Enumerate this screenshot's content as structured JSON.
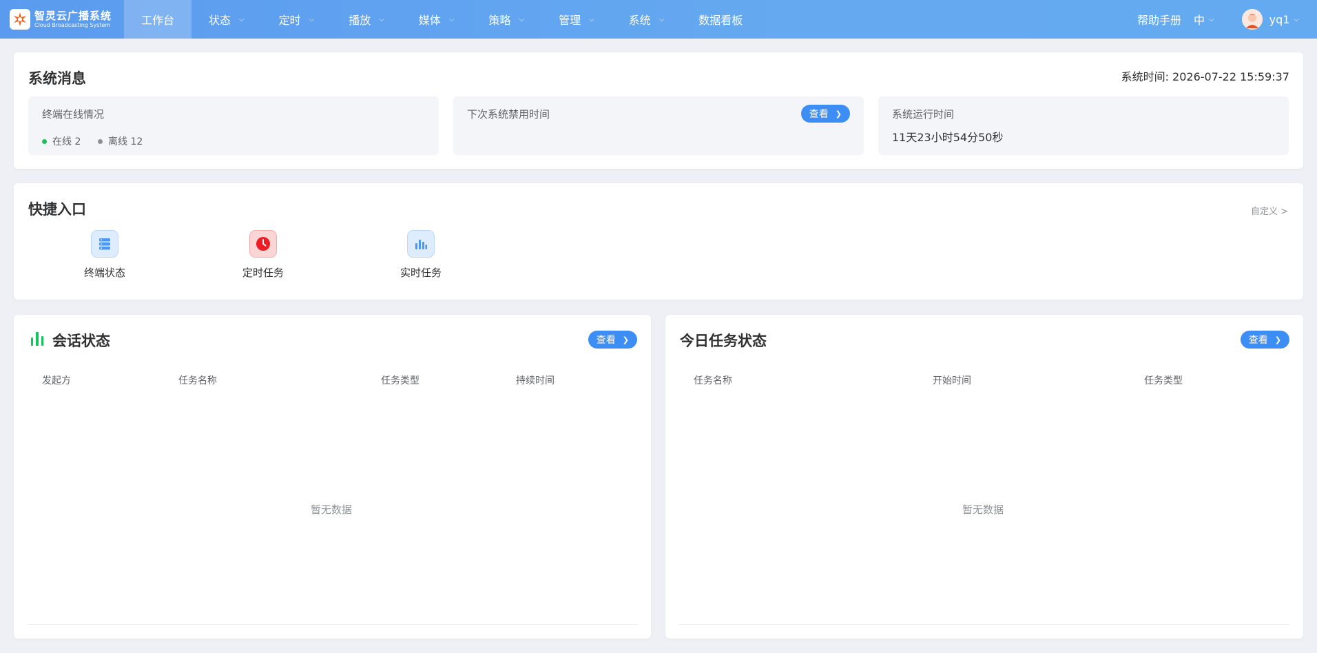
{
  "brand": {
    "title": "智灵云广播系统",
    "subtitle": "Cloud Broadcasting System",
    "logo_color": "#f0621c"
  },
  "nav": {
    "items": [
      {
        "label": "工作台",
        "active": true,
        "has_dropdown": false
      },
      {
        "label": "状态",
        "active": false,
        "has_dropdown": true
      },
      {
        "label": "定时",
        "active": false,
        "has_dropdown": true
      },
      {
        "label": "播放",
        "active": false,
        "has_dropdown": true
      },
      {
        "label": "媒体",
        "active": false,
        "has_dropdown": true
      },
      {
        "label": "策略",
        "active": false,
        "has_dropdown": true
      },
      {
        "label": "管理",
        "active": false,
        "has_dropdown": true
      },
      {
        "label": "系统",
        "active": false,
        "has_dropdown": true
      },
      {
        "label": "数据看板",
        "active": false,
        "has_dropdown": false
      }
    ],
    "help": "帮助手册",
    "lang": "中",
    "username": "yq1"
  },
  "system_message": {
    "title": "系统消息",
    "time_label": "系统时间: 2026-07-22 15:59:37",
    "terminal_panel": {
      "label": "终端在线情况",
      "online_label": "在线 2",
      "offline_label": "离线 12",
      "online_color": "#17c45a",
      "offline_color": "#8c8f95"
    },
    "disable_panel": {
      "label": "下次系统禁用时间",
      "button": "查看"
    },
    "uptime_panel": {
      "label": "系统运行时间",
      "value": "11天23小时54分50秒"
    }
  },
  "quick_entry": {
    "title": "快捷入口",
    "customize": "自定义 >",
    "items": [
      {
        "label": "终端状态",
        "icon": "terminal-status-icon"
      },
      {
        "label": "定时任务",
        "icon": "clock-icon"
      },
      {
        "label": "实时任务",
        "icon": "bar-chart-icon"
      }
    ]
  },
  "session_status": {
    "title": "会话状态",
    "button": "查看",
    "columns": [
      "发起方",
      "任务名称",
      "任务类型",
      "持续时间"
    ],
    "empty": "暂无数据"
  },
  "today_tasks": {
    "title": "今日任务状态",
    "button": "查看",
    "columns": [
      "任务名称",
      "开始时间",
      "任务类型"
    ],
    "empty": "暂无数据"
  }
}
